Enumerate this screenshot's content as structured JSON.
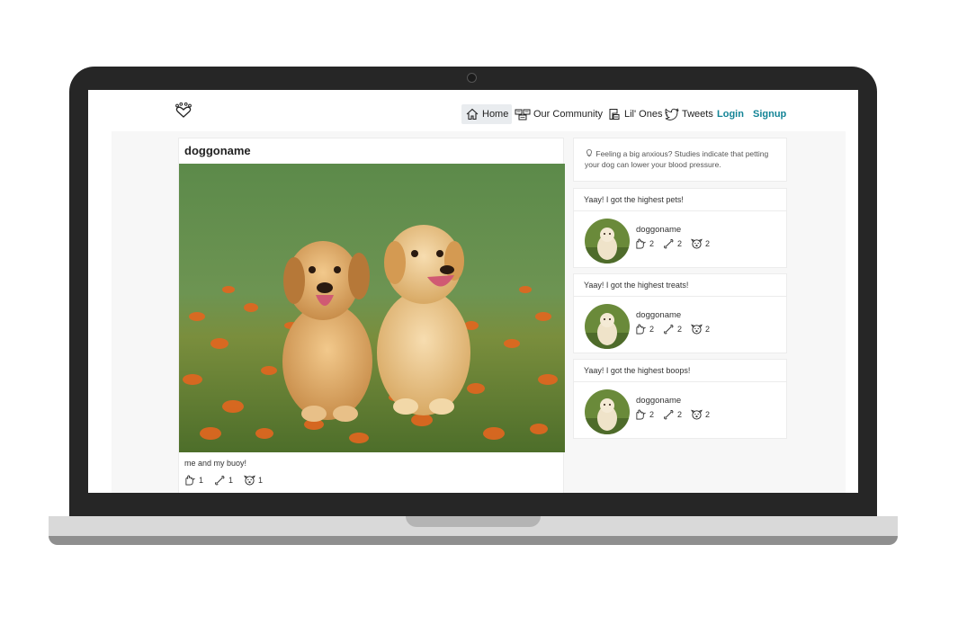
{
  "navbar": {
    "brand_icon": "paw-heart-icon",
    "items": [
      {
        "label": "Home",
        "icon": "home-icon",
        "active": true
      },
      {
        "label": "Our Community",
        "icon": "community-icon"
      },
      {
        "label": "Lil' Ones",
        "icon": "lil-ones-icon"
      },
      {
        "label": "Tweets",
        "icon": "twitter-bird-icon"
      }
    ],
    "login_label": "Login",
    "signup_label": "Signup",
    "accent_color": "#138496"
  },
  "post": {
    "author": "doggoname",
    "image_alt": "puppies-photo",
    "caption": "me and my buoy!",
    "pets": "1",
    "treats": "1",
    "boops": "1"
  },
  "tip": {
    "text": "Feeling a big anxious? Studies indicate that petting your dog can lower your blood pressure."
  },
  "awards": [
    {
      "title": "Yaay! I got the highest pets!",
      "name": "doggoname",
      "pets": "2",
      "treats": "2",
      "boops": "2"
    },
    {
      "title": "Yaay! I got the highest treats!",
      "name": "doggoname",
      "pets": "2",
      "treats": "2",
      "boops": "2"
    },
    {
      "title": "Yaay! I got the highest boops!",
      "name": "doggoname",
      "pets": "2",
      "treats": "2",
      "boops": "2"
    }
  ]
}
